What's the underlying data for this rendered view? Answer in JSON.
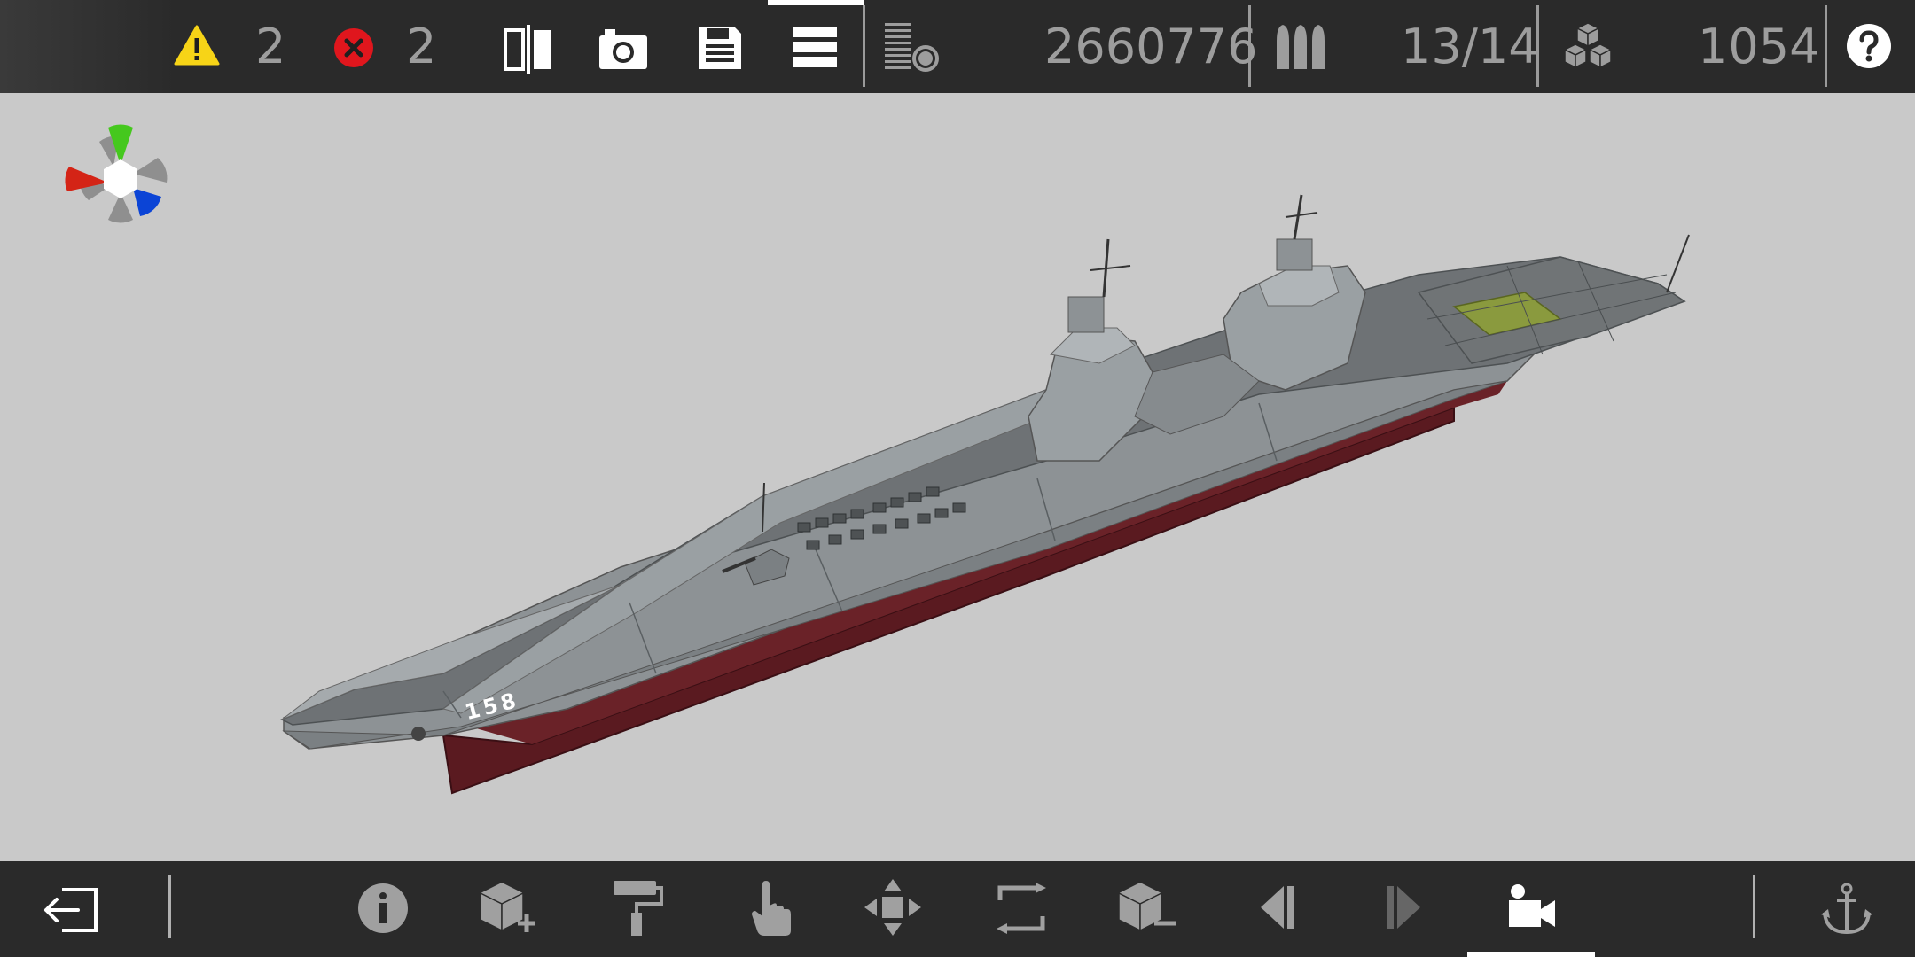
{
  "topbar": {
    "warnings": {
      "icon": "warning-triangle-icon",
      "count": "2",
      "color": "#f7d417"
    },
    "errors": {
      "icon": "error-x-icon",
      "count": "2",
      "color": "#e0161d"
    },
    "tools": [
      {
        "name": "mirror-symmetry-icon"
      },
      {
        "name": "camera-icon"
      },
      {
        "name": "save-disk-icon"
      },
      {
        "name": "menu-list-icon",
        "selected": true
      }
    ],
    "stats": {
      "stats-icon": "stats-list-icon",
      "points": "2660776",
      "ammo_icon": "ammo-shells-icon",
      "weapons": "13/14",
      "blocks_icon": "blocks-stack-icon",
      "blocks": "1054"
    },
    "help_icon": "help-question-icon"
  },
  "viewport": {
    "hull_number": "158",
    "gizmo": {
      "x_color": "#d42416",
      "y_color": "#45c81e",
      "z_color": "#0b44d6"
    },
    "colors": {
      "hull": "#8d9295",
      "hull_light": "#a5aaad",
      "waterline": "#5a1a20",
      "deck": "#6e7275",
      "helipad": "#8a9a3e"
    }
  },
  "bottombar": {
    "tools": [
      {
        "name": "exit-icon"
      },
      {
        "name": "info-icon"
      },
      {
        "name": "add-block-icon"
      },
      {
        "name": "paint-roller-icon"
      },
      {
        "name": "touch-select-icon"
      },
      {
        "name": "move-arrows-icon"
      },
      {
        "name": "rotate-frame-icon"
      },
      {
        "name": "remove-block-icon"
      },
      {
        "name": "previous-step-icon"
      },
      {
        "name": "next-step-icon"
      },
      {
        "name": "camera-view-icon",
        "selected": true
      },
      {
        "name": "anchor-icon"
      }
    ]
  }
}
